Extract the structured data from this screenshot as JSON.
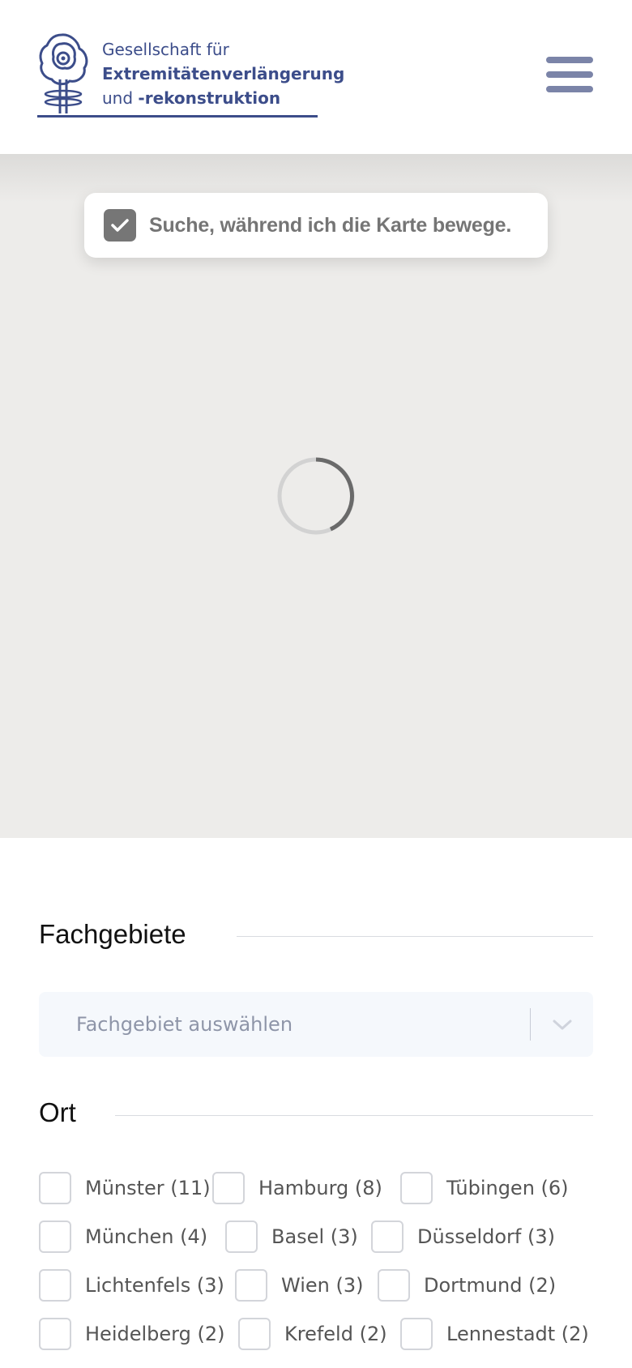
{
  "header": {
    "org_line1": "Gesellschaft für",
    "org_line2": "Extremitätenverlängerung",
    "org_line3_prefix": "und ",
    "org_line3_bold": "-rekonstruktion",
    "brand_color": "#3c4d8a",
    "menu_icon": "hamburger-menu-icon"
  },
  "map": {
    "search_toggle_label": "Suche, während ich die Karte bewege.",
    "search_toggle_checked": true,
    "loading": true
  },
  "filters": {
    "fachgebiete": {
      "title": "Fachgebiete",
      "select_placeholder": "Fachgebiet auswählen"
    },
    "ort": {
      "title": "Ort",
      "cities": [
        "Münster (11)",
        "Hamburg (8)",
        "Tübingen (6)",
        "München (4)",
        "Basel (3)",
        "Düsseldorf (3)",
        "Lichtenfels (3)",
        "Wien (3)",
        "Dortmund (2)",
        "Heidelberg (2)",
        "Krefeld (2)",
        "Lennestadt (2)"
      ]
    }
  }
}
